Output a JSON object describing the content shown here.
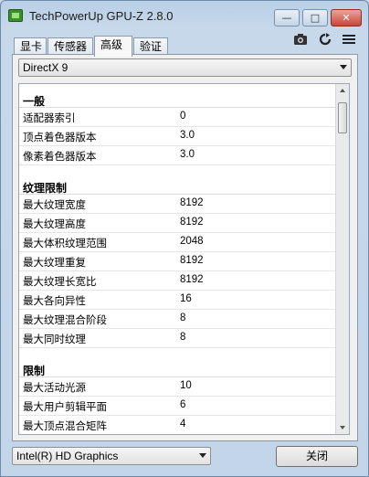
{
  "window": {
    "title": "TechPowerUp GPU-Z 2.8.0",
    "minimize_glyph": "—",
    "maximize_glyph": "□",
    "close_glyph": "✕"
  },
  "tabs": [
    {
      "label": "显卡"
    },
    {
      "label": "传感器"
    },
    {
      "label": "高级",
      "active": true
    },
    {
      "label": "验证"
    }
  ],
  "toolbar": {
    "icons": [
      "camera-icon",
      "refresh-icon",
      "menu-icon"
    ]
  },
  "api_select": {
    "value": "DirectX 9"
  },
  "sections": [
    {
      "title": "一般",
      "rows": [
        {
          "key": "适配器索引",
          "value": "0"
        },
        {
          "key": "顶点着色器版本",
          "value": "3.0"
        },
        {
          "key": "像素着色器版本",
          "value": "3.0"
        }
      ]
    },
    {
      "title": "纹理限制",
      "rows": [
        {
          "key": "最大纹理宽度",
          "value": "8192"
        },
        {
          "key": "最大纹理高度",
          "value": "8192"
        },
        {
          "key": "最大体积纹理范围",
          "value": "2048"
        },
        {
          "key": "最大纹理重复",
          "value": "8192"
        },
        {
          "key": "最大纹理长宽比",
          "value": "8192"
        },
        {
          "key": "最大各向异性",
          "value": "16"
        },
        {
          "key": "最大纹理混合阶段",
          "value": "8"
        },
        {
          "key": "最大同时纹理",
          "value": "8"
        }
      ]
    },
    {
      "title": "限制",
      "rows": [
        {
          "key": "最大活动光源",
          "value": "10"
        },
        {
          "key": "最大用户剪辑平面",
          "value": "6"
        },
        {
          "key": "最大顶点混合矩阵",
          "value": "4"
        }
      ]
    }
  ],
  "footer": {
    "gpu_select": {
      "value": "Intel(R) HD Graphics"
    },
    "close_label": "关闭"
  }
}
